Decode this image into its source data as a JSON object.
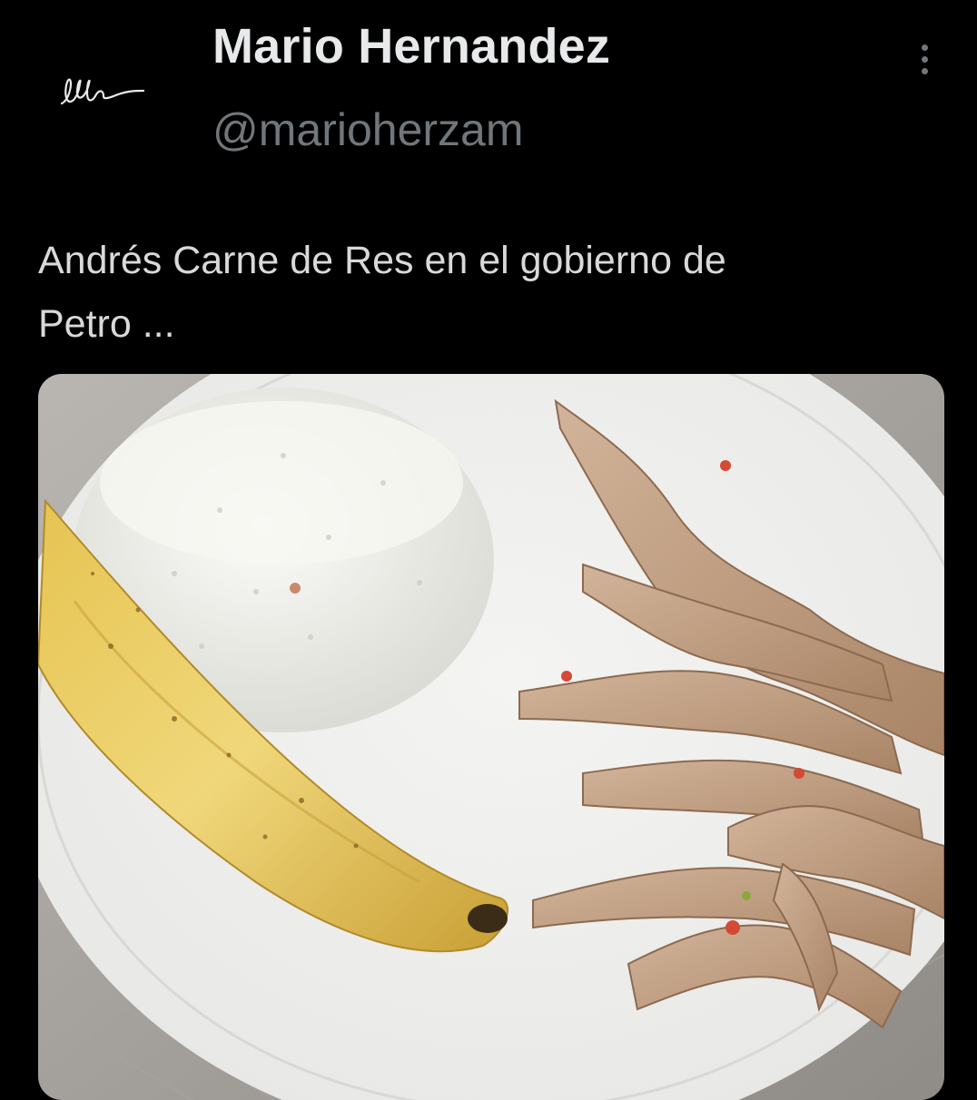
{
  "tweet": {
    "author": {
      "display_name": "Mario Hernandez",
      "handle": "@marioherzam",
      "avatar": "handwritten-signature"
    },
    "more_icon": "vertical-ellipsis-icon",
    "text": "Andrés Carne de Res en el gobierno de\nPetro ...",
    "media": {
      "kind": "photo",
      "depicts": [
        "plate",
        "banana",
        "rice",
        "chicken-feet"
      ]
    }
  },
  "colors": {
    "background": "#000000",
    "name": "#e7e9ea",
    "handle": "#71767b",
    "body_text": "#d9d9d9"
  }
}
